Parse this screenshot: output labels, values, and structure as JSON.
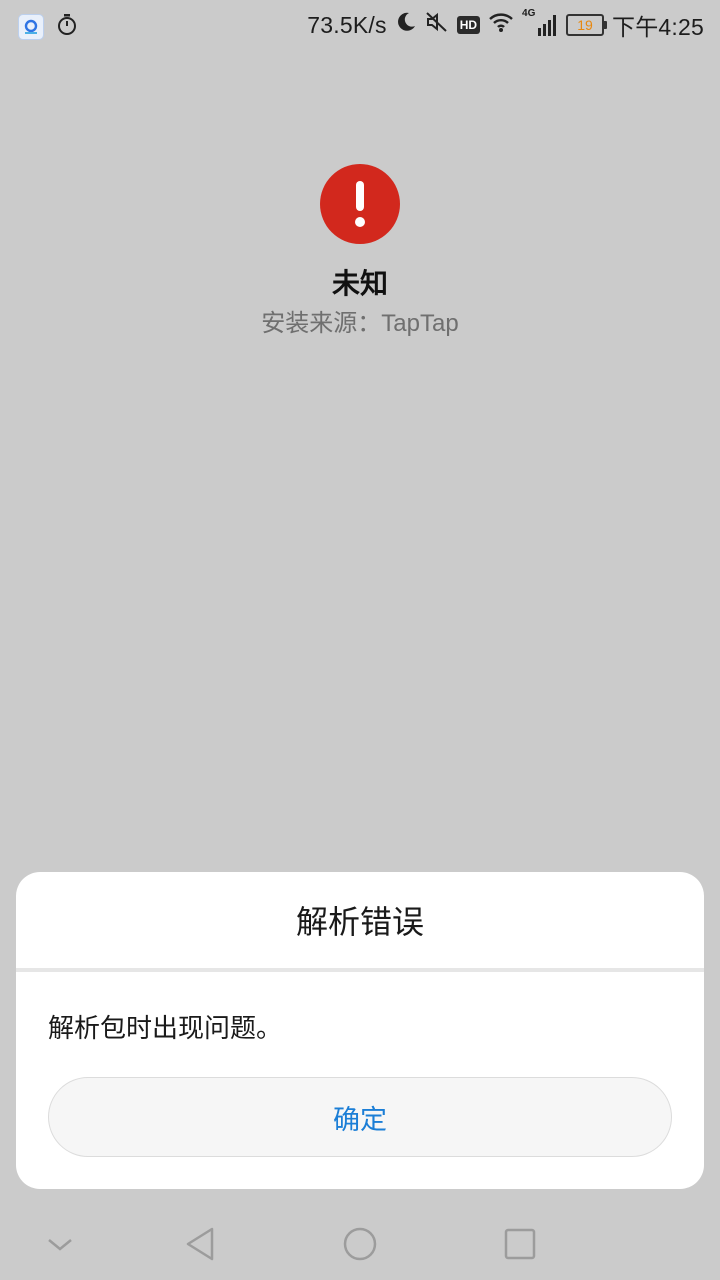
{
  "status_bar": {
    "left_icons": [
      "app-notification-icon",
      "timer-icon"
    ],
    "net_speed": "73.5K/s",
    "icons": [
      "moon-icon",
      "mute-icon",
      "hd-icon",
      "wifi-icon",
      "cellular-4g-icon"
    ],
    "hd_label": "HD",
    "network_label": "4G",
    "battery_level": "19",
    "battery_color": "#e8880f",
    "time": "下午4:25"
  },
  "app": {
    "icon": "warning-circle-icon",
    "icon_color": "#d2281d",
    "name": "未知",
    "source_label": "安装来源：",
    "source_value": "TapTap"
  },
  "dialog": {
    "title": "解析错误",
    "message": "解析包时出现问题。",
    "ok_label": "确定",
    "ok_color": "#1b7ed6"
  },
  "nav_bar": {
    "items": [
      "collapse-chevron-icon",
      "back-triangle-icon",
      "home-circle-icon",
      "recents-square-icon"
    ]
  }
}
